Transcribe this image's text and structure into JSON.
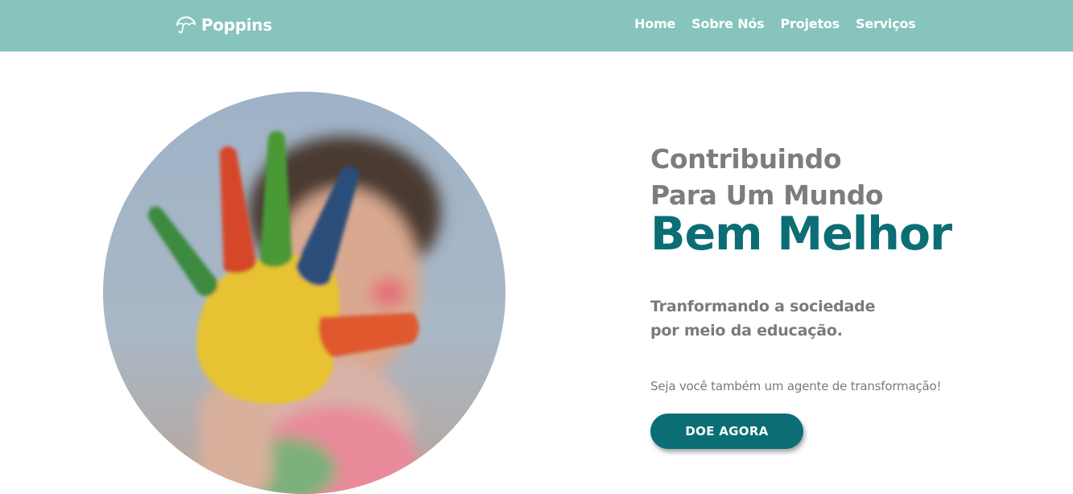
{
  "navbar": {
    "brand": {
      "name": "Poppins",
      "icon": "umbrella-icon"
    },
    "links": [
      "Home",
      "Sobre Nós",
      "Projetos",
      "Serviços"
    ],
    "background_color": "#86c4bd"
  },
  "hero": {
    "image": "child-painted-hand-photo",
    "title_line_1": "Contribuindo",
    "title_line_2": "Para Um Mundo",
    "title_emphasis": "Bem Melhor",
    "subtitle_line_1": "Tranformando a sociedade",
    "subtitle_line_2": "por meio da educação.",
    "call_to_action_text": "Seja você também um agente de transformação!",
    "button_label": "DOE AGORA",
    "accent_color": "#0b6e75",
    "heading_color": "#7d7d7d"
  }
}
